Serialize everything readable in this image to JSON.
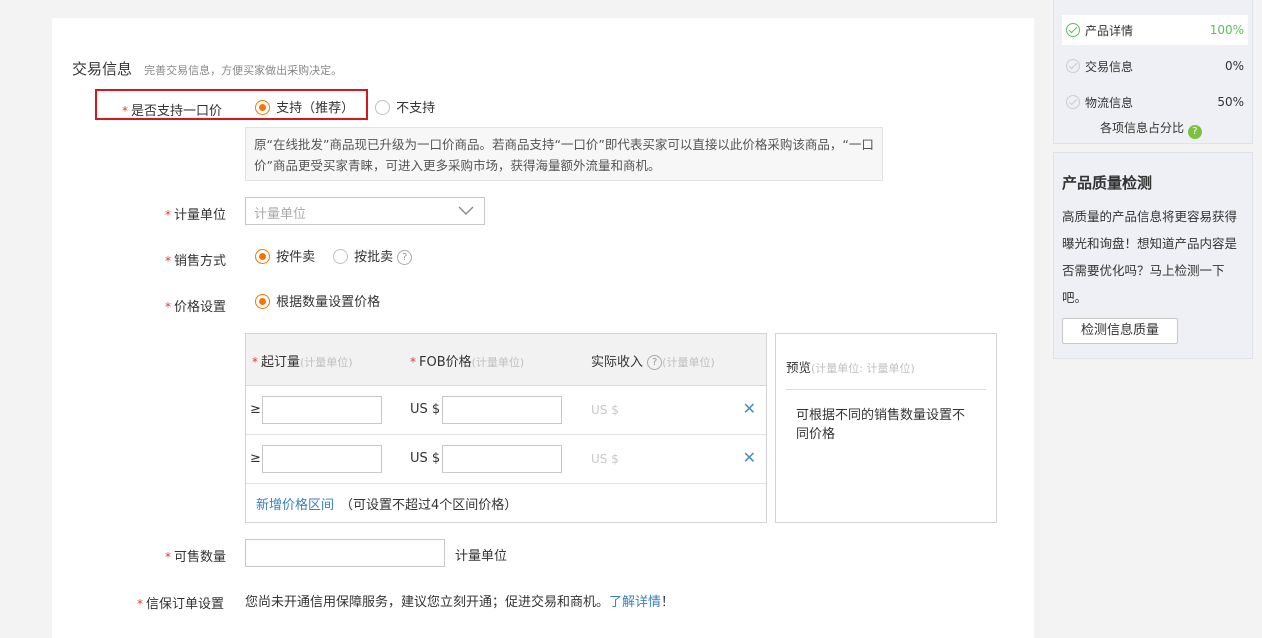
{
  "section": {
    "title": "交易信息",
    "subtitle": "完善交易信息，方便买家做出采购决定。"
  },
  "one_price": {
    "label": "是否支持一口价",
    "option_yes": "支持（推荐）",
    "option_no": "不支持",
    "note": "原“在线批发”商品现已升级为一口价商品。若商品支持“一口价”即代表买家可以直接以此价格采购该商品，“一口价”商品更受买家青睐，可进入更多采购市场，获得海量额外流量和商机。"
  },
  "unit": {
    "label": "计量单位",
    "placeholder": "计量单位"
  },
  "sale_method": {
    "label": "销售方式",
    "option_piece": "按件卖",
    "option_batch": "按批卖"
  },
  "price_setting": {
    "label": "价格设置",
    "option": "根据数量设置价格"
  },
  "price_table": {
    "col_moq": "起订量",
    "col_moq_sub": "(计量单位)",
    "col_fob": "FOB价格",
    "col_fob_sub": "(计量单位)",
    "col_income": "实际收入",
    "col_income_sub": "(计量单位)",
    "rows": [
      {
        "ge": "≥",
        "currency": "US $",
        "income": "US $"
      },
      {
        "ge": "≥",
        "currency": "US $",
        "income": "US $"
      }
    ],
    "add_link": "新增价格区间",
    "add_note": "（可设置不超过4个区间价格）"
  },
  "preview": {
    "title": "预览",
    "title_sub": "(计量单位: 计量单位)",
    "body": "可根据不同的销售数量设置不同价格"
  },
  "quantity": {
    "label": "可售数量",
    "unit": "计量单位"
  },
  "escrow": {
    "label": "信保订单设置",
    "text": "您尚未开通信用保障服务，建议您立刻开通；促进交易和商机。",
    "link": "了解详情",
    "tail": "！"
  },
  "progress": {
    "items": [
      {
        "label": "产品详情",
        "value": "100%"
      },
      {
        "label": "交易信息",
        "value": "0%"
      },
      {
        "label": "物流信息",
        "value": "50%"
      }
    ],
    "footer": "各项信息占分比"
  },
  "quality": {
    "title": "产品质量检测",
    "desc": "高质量的产品信息将更容易获得曝光和询盘！想知道产品内容是否需要优化吗？马上检测一下吧。",
    "button": "检测信息质量"
  },
  "colors": {
    "accent": "#ff7300",
    "required": "#e4393c",
    "link": "#3b7fbf",
    "success": "#5dbf5d",
    "highlight_border": "#d9161c"
  }
}
